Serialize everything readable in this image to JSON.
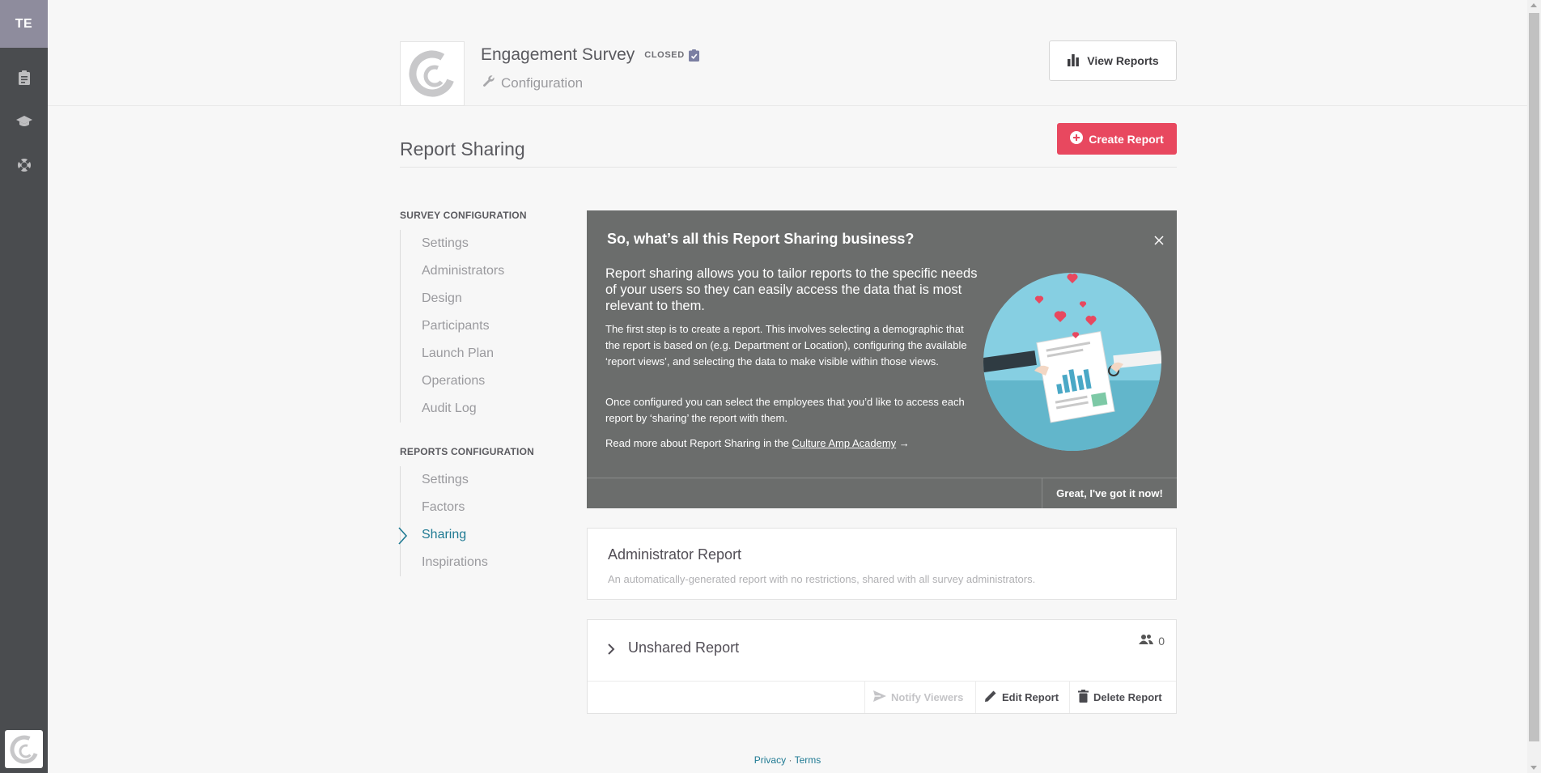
{
  "rail": {
    "avatar_initials": "TE",
    "icons": [
      "clipboard-icon",
      "graduation-cap-icon",
      "lifebuoy-icon"
    ],
    "logo_icon": "culture-amp-logo-icon"
  },
  "header": {
    "survey_title": "Engagement Survey",
    "status": "CLOSED",
    "subtitle": "Configuration",
    "view_reports_label": "View Reports"
  },
  "page": {
    "title": "Report Sharing",
    "create_report_label": "Create Report"
  },
  "nav": {
    "survey_heading": "SURVEY CONFIGURATION",
    "survey_items": [
      "Settings",
      "Administrators",
      "Design",
      "Participants",
      "Launch Plan",
      "Operations",
      "Audit Log"
    ],
    "reports_heading": "REPORTS CONFIGURATION",
    "reports_items": [
      "Settings",
      "Factors",
      "Sharing",
      "Inspirations"
    ],
    "active_item": "Sharing"
  },
  "info": {
    "title": "So, what’s all this Report Sharing business?",
    "lead": "Report sharing allows you to tailor reports to the specific needs of your users so they can easily access the data that is most relevant to them.",
    "p1": "The first step is to create a report. This involves selecting a demographic that the report is based on (e.g. Department or Location), configuring the available ‘report views’, and selecting the data to make visible within those views.",
    "p2": "Once configured you can select the employees that you’d like to access each report by ‘sharing’ the report with them.",
    "p3_prefix": "Read more about Report Sharing in the ",
    "p3_link": "Culture Amp Academy",
    "p3_suffix": " →",
    "got_it_label": "Great, I've got it now!"
  },
  "reports": {
    "admin": {
      "title": "Administrator Report",
      "description": "An automatically-generated report with no restrictions, shared with all survey administrators."
    },
    "unshared": {
      "title": "Unshared Report",
      "viewer_count": "0",
      "notify_label": "Notify Viewers",
      "edit_label": "Edit Report",
      "delete_label": "Delete Report"
    }
  },
  "footer": {
    "privacy": "Privacy",
    "separator": " · ",
    "terms": "Terms"
  },
  "colors": {
    "rail_bg": "#4a4c4f",
    "avatar_bg": "#8e8c9d",
    "accent_red": "#e8485f",
    "info_bg": "#6b6d6c",
    "link_teal": "#1f7a93"
  }
}
